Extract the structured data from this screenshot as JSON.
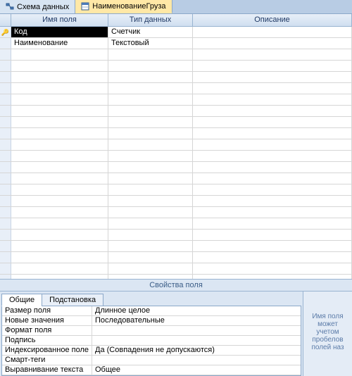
{
  "tabs": [
    {
      "label": "Схема данных",
      "active": false
    },
    {
      "label": "НаименованиеГруза",
      "active": true
    }
  ],
  "columns": {
    "name": "Имя поля",
    "type": "Тип данных",
    "desc": "Описание"
  },
  "fields": [
    {
      "name": "Код",
      "type": "Счетчик",
      "pk": true,
      "selected": true
    },
    {
      "name": "Наименование",
      "type": "Текстовый",
      "pk": false,
      "selected": false
    }
  ],
  "emptyRows": 21,
  "propCaption": "Свойства поля",
  "propTabs": [
    {
      "label": "Общие",
      "active": true
    },
    {
      "label": "Подстановка",
      "active": false
    }
  ],
  "properties": [
    {
      "label": "Размер поля",
      "value": "Длинное целое"
    },
    {
      "label": "Новые значения",
      "value": "Последовательные"
    },
    {
      "label": "Формат поля",
      "value": ""
    },
    {
      "label": "Подпись",
      "value": ""
    },
    {
      "label": "Индексированное поле",
      "value": "Да (Совпадения не допускаются)"
    },
    {
      "label": "Смарт-теги",
      "value": ""
    },
    {
      "label": "Выравнивание текста",
      "value": "Общее"
    }
  ],
  "helpText": "Имя поля может\nучетом пробелов\nполей наз"
}
